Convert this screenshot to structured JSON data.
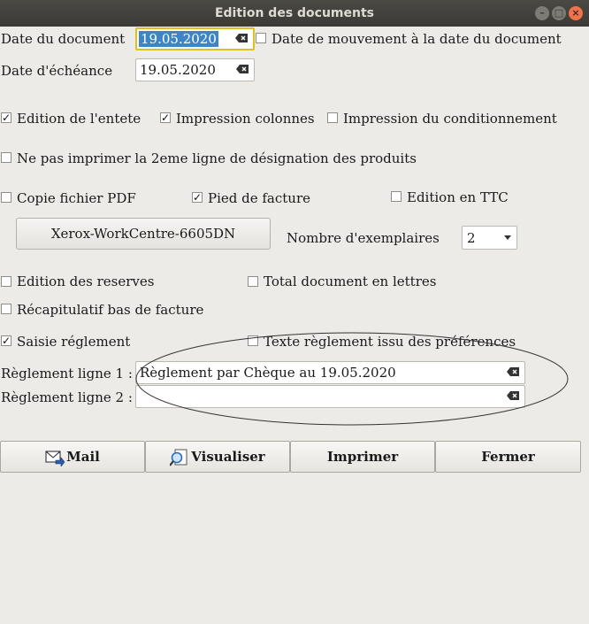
{
  "window": {
    "title": "Edition des documents"
  },
  "dates": {
    "doc_label": "Date du document",
    "doc_value": "19.05.2020",
    "move_label": "Date de mouvement à la date du document",
    "due_label": "Date d'échéance",
    "due_value": "19.05.2020"
  },
  "options": {
    "entete": "Edition de l'entete",
    "colonnes": "Impression colonnes",
    "conditionnement": "Impression du conditionnement",
    "ligne2": "Ne pas imprimer la 2eme ligne de désignation des produits",
    "pdf": "Copie fichier PDF",
    "pied": "Pied de facture",
    "ttc": "Edition en TTC",
    "reserves": "Edition des reserves",
    "total_lettres": "Total document en lettres",
    "recap": "Récapitulatif bas de facture",
    "saisie_reglement": "Saisie réglement",
    "texte_reglement": "Texte règlement issu des préférences"
  },
  "printer": {
    "name": "Xerox-WorkCentre-6605DN",
    "copies_label": "Nombre d'exemplaires",
    "copies_value": "2"
  },
  "reglement": {
    "line1_label": "Règlement ligne 1 :",
    "line1_value": "Règlement par Chèque au 19.05.2020",
    "line2_label": "Règlement ligne 2 :",
    "line2_value": ""
  },
  "actions": {
    "mail": "Mail",
    "visualiser": "Visualiser",
    "imprimer": "Imprimer",
    "fermer": "Fermer"
  },
  "checked": {
    "move": false,
    "entete": true,
    "colonnes": true,
    "conditionnement": false,
    "ligne2": false,
    "pdf": false,
    "pied": true,
    "ttc": false,
    "reserves": false,
    "total_lettres": false,
    "recap": false,
    "saisie_reglement": true,
    "texte_reglement": false
  }
}
